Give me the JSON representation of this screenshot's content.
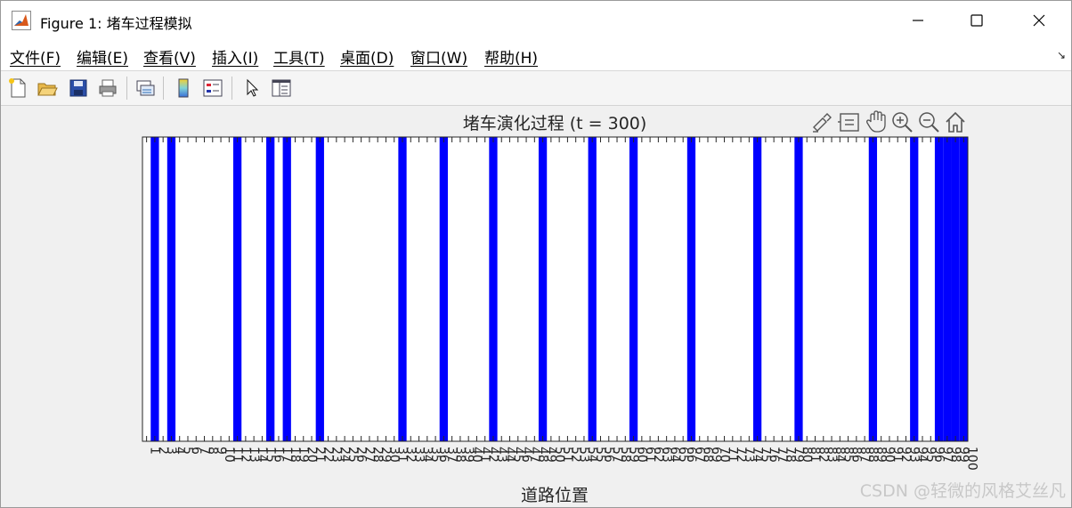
{
  "window": {
    "title": "Figure 1: 堵车过程模拟"
  },
  "menu": [
    {
      "label": "文件(F)"
    },
    {
      "label": "编辑(E)"
    },
    {
      "label": "查看(V)"
    },
    {
      "label": "插入(I)"
    },
    {
      "label": "工具(T)"
    },
    {
      "label": "桌面(D)"
    },
    {
      "label": "窗口(W)"
    },
    {
      "label": "帮助(H)"
    }
  ],
  "toolbar": {
    "icons": [
      "new-figure-icon",
      "open-file-icon",
      "save-icon",
      "print-icon",
      "link-plot-icon",
      "insert-colorbar-icon",
      "insert-legend-icon",
      "edit-plot-arrow-icon",
      "property-inspector-icon"
    ]
  },
  "axes_toolbar": {
    "icons": [
      "brush-icon",
      "data-tips-icon",
      "pan-hand-icon",
      "zoom-in-icon",
      "zoom-out-icon",
      "home-icon"
    ]
  },
  "chart_data": {
    "type": "heatmap",
    "title": "堵车演化过程 (t = 300)",
    "xlabel": "道路位置",
    "ylabel": "",
    "xlim": [
      0.5,
      100.5
    ],
    "x_ticks": [
      1,
      2,
      3,
      4,
      5,
      6,
      7,
      8,
      9,
      10,
      11,
      12,
      13,
      14,
      15,
      16,
      17,
      18,
      19,
      20,
      21,
      22,
      23,
      24,
      25,
      26,
      27,
      28,
      29,
      30,
      31,
      32,
      33,
      34,
      35,
      36,
      37,
      38,
      39,
      40,
      41,
      42,
      43,
      44,
      45,
      46,
      47,
      48,
      49,
      50,
      51,
      52,
      53,
      54,
      55,
      56,
      57,
      58,
      59,
      60,
      61,
      62,
      63,
      64,
      65,
      66,
      67,
      68,
      69,
      70,
      71,
      72,
      73,
      74,
      75,
      76,
      77,
      78,
      79,
      80,
      81,
      82,
      83,
      84,
      85,
      86,
      87,
      88,
      89,
      90,
      91,
      92,
      93,
      94,
      95,
      96,
      97,
      98,
      99,
      100
    ],
    "occupied_positions": [
      2,
      4,
      12,
      16,
      18,
      22,
      32,
      37,
      43,
      49,
      55,
      60,
      67,
      75,
      80,
      89,
      94,
      97,
      98,
      99,
      100
    ],
    "colors": {
      "occupied": "#0000ff",
      "empty": "#ffffff"
    },
    "grid": false
  },
  "watermark": "CSDN @轻微的风格艾丝凡"
}
